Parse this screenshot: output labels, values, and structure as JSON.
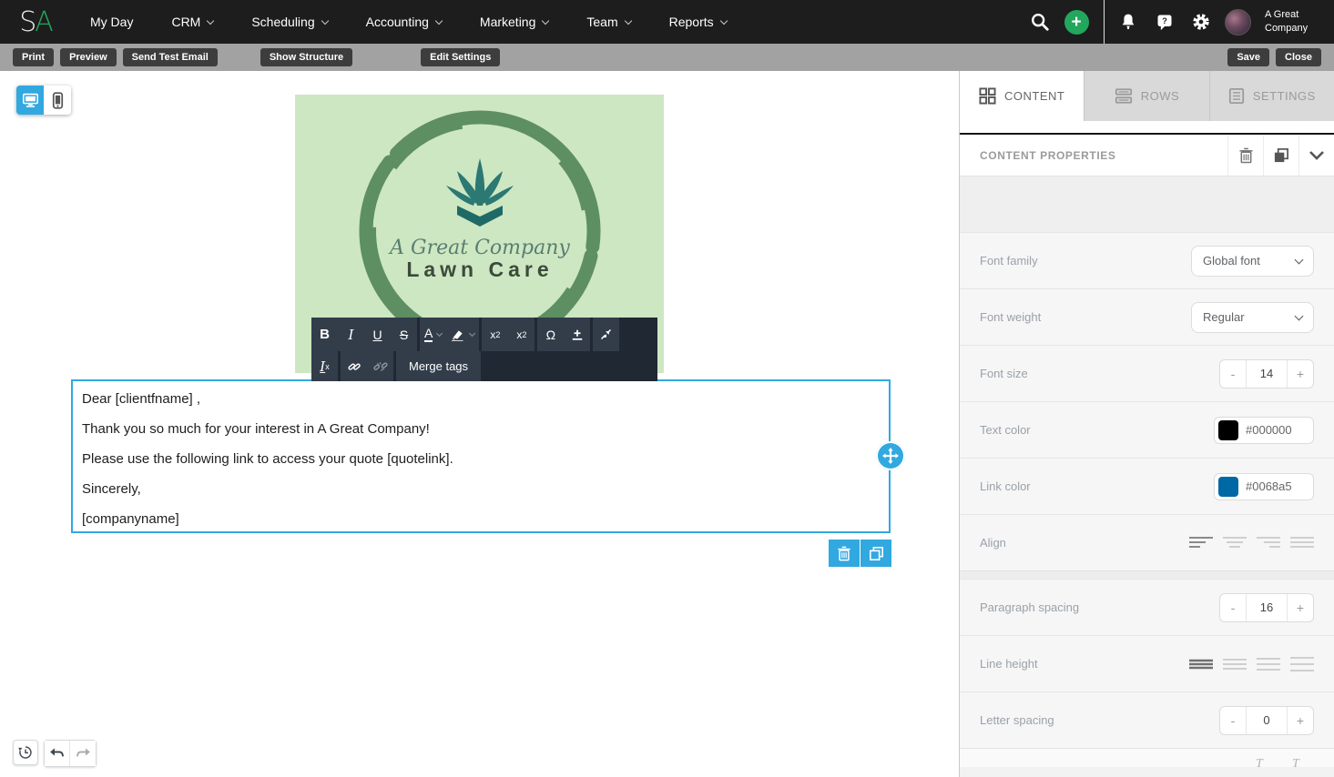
{
  "nav": {
    "logo_s": "S",
    "logo_a": "A",
    "items": [
      {
        "label": "My Day"
      },
      {
        "label": "CRM"
      },
      {
        "label": "Scheduling"
      },
      {
        "label": "Accounting"
      },
      {
        "label": "Marketing"
      },
      {
        "label": "Team"
      },
      {
        "label": "Reports"
      }
    ],
    "plus_label": "+",
    "account_name": "A Great Company"
  },
  "toolbar": {
    "print": "Print",
    "preview": "Preview",
    "send_test_email": "Send Test Email",
    "show_structure": "Show Structure",
    "edit_settings": "Edit Settings",
    "save": "Save",
    "close": "Close"
  },
  "editor": {
    "text_toolbar": {
      "bold": "B",
      "italic": "I",
      "underline": "U",
      "strikethrough": "S",
      "font_color": "A",
      "superscript_base": "x",
      "superscript_exp": "2",
      "subscript_base": "x",
      "subscript_sub": "2",
      "special_char": "Ω",
      "clear_format_i": "I",
      "clear_format_x": "x",
      "merge_tags_label": "Merge tags"
    },
    "email": {
      "logo": {
        "script_line": "A Great Company",
        "title_line": "Lawn Care"
      },
      "paragraphs": [
        "Dear [clientfname] ,",
        "Thank you so much for your interest in A Great Company!",
        "Please use the following link to access your quote [quotelink].",
        "Sincerely,",
        "[companyname]"
      ]
    }
  },
  "panel": {
    "tabs": [
      {
        "label": "CONTENT"
      },
      {
        "label": "ROWS"
      },
      {
        "label": "SETTINGS"
      }
    ],
    "header": "CONTENT PROPERTIES",
    "stepper": {
      "minus": "-",
      "plus": "+"
    },
    "font_family": {
      "label": "Font family",
      "value": "Global font"
    },
    "font_weight": {
      "label": "Font weight",
      "value": "Regular"
    },
    "font_size": {
      "label": "Font size",
      "value": "14"
    },
    "text_color": {
      "label": "Text color",
      "value": "#000000",
      "swatch": "#000000"
    },
    "link_color": {
      "label": "Link color",
      "value": "#0068a5",
      "swatch": "#0068a5"
    },
    "align": {
      "label": "Align"
    },
    "paragraph_spacing": {
      "label": "Paragraph spacing",
      "value": "16"
    },
    "line_height": {
      "label": "Line height"
    },
    "letter_spacing": {
      "label": "Letter spacing",
      "value": "0"
    }
  },
  "colors": {
    "accent_blue": "#31a8e0",
    "accent_green": "#22a75d",
    "logo_background": "#cde7c2"
  }
}
